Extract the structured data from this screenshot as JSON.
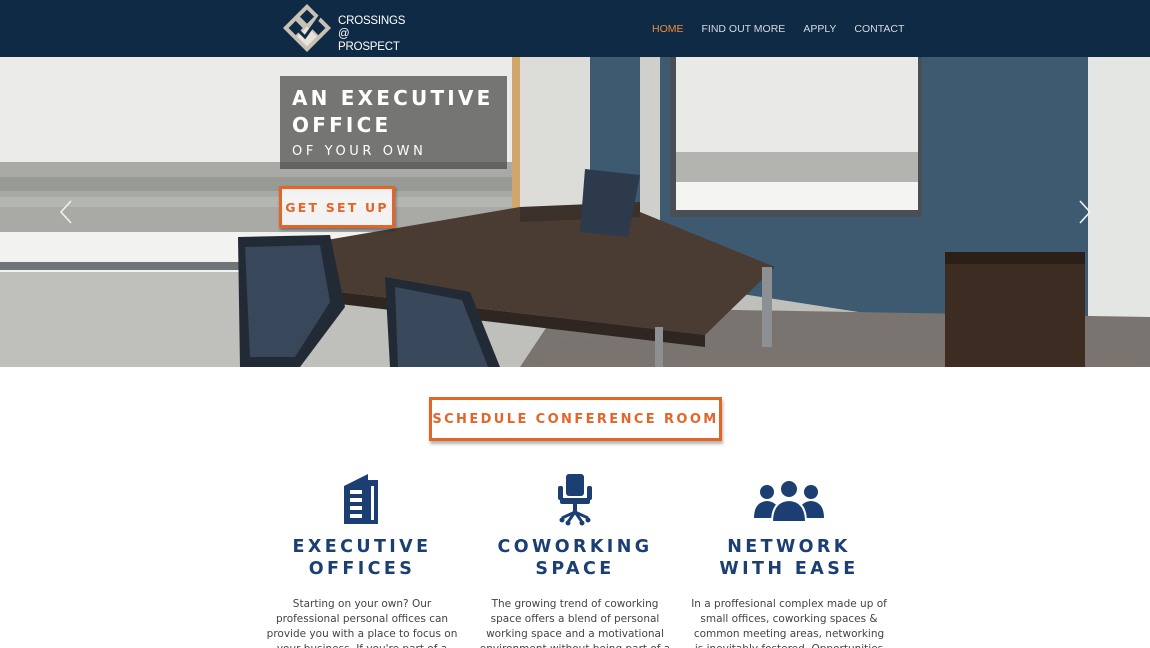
{
  "header": {
    "logo_line1": "CROSSINGS",
    "logo_line2": "@ PROSPECT",
    "nav": [
      {
        "label": "HOME",
        "active": true
      },
      {
        "label": "FIND OUT MORE",
        "active": false
      },
      {
        "label": "APPLY",
        "active": false
      },
      {
        "label": "CONTACT",
        "active": false
      }
    ]
  },
  "hero": {
    "headline_line1": "AN EXECUTIVE",
    "headline_line2": "OFFICE",
    "subline": "OF YOUR OWN",
    "cta_label": "GET SET UP",
    "slide_count": 3
  },
  "conference_button_label": "SCHEDULE CONFERENCE ROOM",
  "features": [
    {
      "icon": "office-building-icon",
      "title_line1": "EXECUTIVE",
      "title_line2": "OFFICES",
      "body": "Starting on your own? Our professional personal offices can provide you with a place to focus on your business. If you're part of a"
    },
    {
      "icon": "office-chair-icon",
      "title_line1": "COWORKING",
      "title_line2": "SPACE",
      "body": "The growing trend of coworking space offers a blend of personal working space and a motivational environment without being part of a"
    },
    {
      "icon": "people-group-icon",
      "title_line1": "NETWORK",
      "title_line2": "WITH EASE",
      "body": "In a proffesional complex made up of small offices, coworking spaces & common meeting areas, networking is inevitably fostered. Opportunities"
    }
  ],
  "colors": {
    "header_bg": "#0f2a45",
    "accent_orange": "#e3652a",
    "nav_active": "#f08a3c",
    "feature_blue": "#1b3f73"
  }
}
